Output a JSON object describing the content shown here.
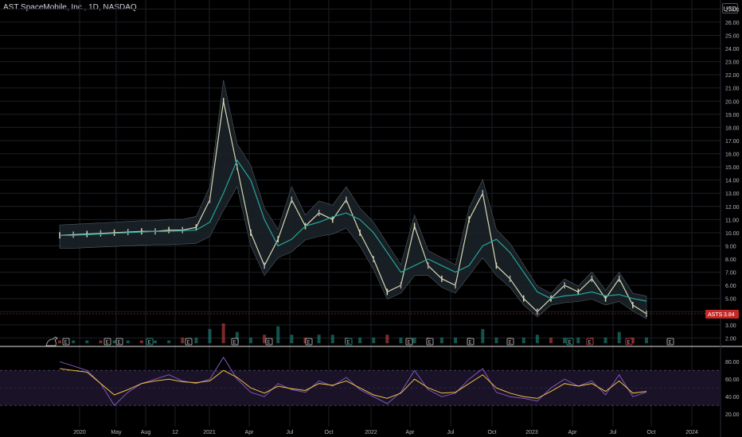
{
  "header": {
    "title": "AST SpaceMobile, Inc., 1D, NASDAQ",
    "currency": "USD"
  },
  "colors": {
    "background": "#000000",
    "grid": "#1c1f26",
    "candle_up": "#d8d8b0",
    "candle_down": "#a9a9a9",
    "ma_line": "#26a69a",
    "band": "#5b6670",
    "rsi_line": "#7e57c2",
    "rsi_ma": "#f0c040",
    "price_badge": "#c62828",
    "volume": "#26a69a"
  },
  "chart_data": [
    {
      "type": "line",
      "symbol": "ASTS",
      "last_price": "3.84",
      "y_ticks": [
        "27.00",
        "26.00",
        "25.00",
        "24.00",
        "23.00",
        "22.00",
        "21.00",
        "20.00",
        "19.00",
        "18.00",
        "17.00",
        "16.00",
        "15.00",
        "14.00",
        "13.00",
        "12.00",
        "11.00",
        "10.00",
        "9.00",
        "8.00",
        "7.00",
        "6.00",
        "5.00",
        "4.00",
        "3.00",
        "2.00"
      ],
      "x_ticks": [
        "2020",
        "May",
        "Aug",
        "12",
        "2021",
        "Apr",
        "Jul",
        "Oct",
        "2022",
        "Apr",
        "Jul",
        "Oct",
        "2023",
        "Apr",
        "Jul",
        "Oct",
        "2024"
      ],
      "ylim": [
        1.6,
        27.2
      ],
      "x": [
        "2020-02",
        "2020-03",
        "2020-04",
        "2020-05",
        "2020-06",
        "2020-07",
        "2020-08",
        "2020-09",
        "2020-10",
        "2020-11",
        "2020-12",
        "2021-01",
        "2021-02",
        "2021-03",
        "2021-04",
        "2021-05",
        "2021-06",
        "2021-07",
        "2021-08",
        "2021-09",
        "2021-10",
        "2021-11",
        "2021-12",
        "2022-01",
        "2022-02",
        "2022-03",
        "2022-04",
        "2022-05",
        "2022-06",
        "2022-07",
        "2022-08",
        "2022-09",
        "2022-10",
        "2022-11",
        "2022-12",
        "2023-01",
        "2023-02",
        "2023-03",
        "2023-04",
        "2023-05",
        "2023-06",
        "2023-07",
        "2023-08",
        "2023-09"
      ],
      "series": [
        {
          "values": [
            9.8,
            9.85,
            9.9,
            9.95,
            10.0,
            10.05,
            10.1,
            10.1,
            10.2,
            10.2,
            10.4,
            12.5,
            20.0,
            15.0,
            10.0,
            7.5,
            9.5,
            12.5,
            10.5,
            11.5,
            11.0,
            12.5,
            10.0,
            8.0,
            5.5,
            6.0,
            10.5,
            7.5,
            6.5,
            6.0,
            11.0,
            13.0,
            7.5,
            6.5,
            5.0,
            4.0,
            5.0,
            6.0,
            5.5,
            6.5,
            5.0,
            6.5,
            4.5,
            3.84
          ]
        },
        {
          "values": [
            9.8,
            9.8,
            9.85,
            9.9,
            9.95,
            10.0,
            10.05,
            10.1,
            10.1,
            10.15,
            10.2,
            10.8,
            13.0,
            15.5,
            14.0,
            11.0,
            9.0,
            9.5,
            10.5,
            10.8,
            11.2,
            11.5,
            11.0,
            10.0,
            8.5,
            7.0,
            7.5,
            8.0,
            7.5,
            7.0,
            7.5,
            9.0,
            9.5,
            8.5,
            7.0,
            5.5,
            5.0,
            5.2,
            5.3,
            5.5,
            5.2,
            5.3,
            5.0,
            4.8
          ]
        }
      ],
      "volume": [
        1,
        1,
        1,
        1,
        1,
        1,
        1,
        1,
        1,
        2,
        2,
        5,
        7,
        4,
        2,
        3,
        6,
        3,
        2,
        3,
        3,
        2,
        2,
        2,
        3,
        2,
        2,
        2,
        2,
        2,
        2,
        5,
        2,
        2,
        2,
        3,
        2,
        2,
        2,
        2,
        2,
        4,
        2,
        2
      ],
      "event_markers": [
        "E",
        "E",
        "E",
        "E",
        "E",
        "E",
        "E",
        "E",
        "E",
        "E",
        "E",
        "E",
        "E",
        "E",
        "E",
        "E",
        "E",
        "E",
        "E",
        "E"
      ]
    },
    {
      "type": "line",
      "indicator": "RSI",
      "y_ticks": [
        "80.00",
        "60.00",
        "40.00",
        "20.00"
      ],
      "ylim": [
        12,
        92
      ],
      "bands": [
        70,
        30
      ],
      "series": [
        {
          "values": [
            80,
            75,
            70,
            55,
            30,
            45,
            55,
            60,
            65,
            58,
            55,
            60,
            85,
            60,
            45,
            40,
            55,
            48,
            45,
            58,
            52,
            62,
            48,
            40,
            32,
            45,
            70,
            48,
            40,
            44,
            60,
            72,
            45,
            40,
            38,
            35,
            50,
            60,
            52,
            58,
            42,
            65,
            40,
            45
          ]
        },
        {
          "values": [
            72,
            70,
            68,
            55,
            42,
            48,
            55,
            58,
            60,
            57,
            56,
            58,
            70,
            62,
            50,
            44,
            52,
            49,
            47,
            55,
            53,
            58,
            50,
            42,
            38,
            44,
            60,
            50,
            44,
            45,
            55,
            65,
            50,
            44,
            40,
            38,
            46,
            55,
            52,
            55,
            46,
            58,
            44,
            46
          ]
        }
      ]
    }
  ]
}
